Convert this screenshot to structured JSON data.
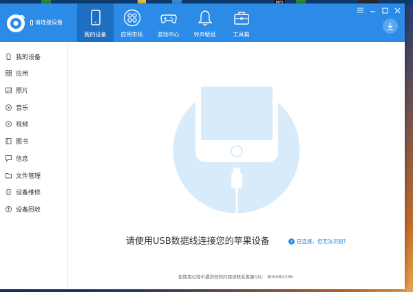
{
  "desktop": {
    "taskbar_badge": "MP3"
  },
  "header": {
    "device_status": "请连接设备",
    "nav": [
      {
        "label": "我的设备",
        "icon": "phone-icon",
        "active": true
      },
      {
        "label": "应用市场",
        "icon": "apps-icon",
        "active": false
      },
      {
        "label": "游戏中心",
        "icon": "gamepad-icon",
        "active": false
      },
      {
        "label": "铃声壁纸",
        "icon": "bell-icon",
        "active": false
      },
      {
        "label": "工具箱",
        "icon": "toolbox-icon",
        "active": false
      }
    ],
    "accent": "#2b8be6"
  },
  "sidebar": {
    "items": [
      {
        "label": "我的设备",
        "icon": "device-icon"
      },
      {
        "label": "应用",
        "icon": "apps-icon"
      },
      {
        "label": "照片",
        "icon": "photo-icon"
      },
      {
        "label": "音乐",
        "icon": "music-icon"
      },
      {
        "label": "视频",
        "icon": "video-icon"
      },
      {
        "label": "图书",
        "icon": "book-icon"
      },
      {
        "label": "信息",
        "icon": "message-icon"
      },
      {
        "label": "文件管理",
        "icon": "folder-icon"
      },
      {
        "label": "设备维修",
        "icon": "repair-icon"
      },
      {
        "label": "设备回收",
        "icon": "recycle-icon"
      }
    ]
  },
  "main": {
    "prompt": "请使用USB数据线连接您的苹果设备",
    "help_link": "已连接，但无法识别?",
    "footer": "如使用过程中遇到任何问题请联系客服QQ：  800081336"
  }
}
